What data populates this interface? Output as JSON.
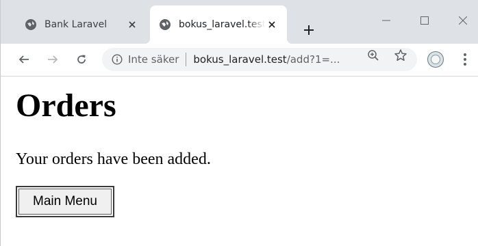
{
  "tabs": [
    {
      "title": "Bank Laravel",
      "active": false
    },
    {
      "title": "bokus_laravel.test",
      "active": true
    }
  ],
  "new_tab_label": "+",
  "omnibox": {
    "security_label": "Inte säker",
    "url_host": "bokus_laravel.test",
    "url_path": "/add?1=..."
  },
  "page": {
    "heading": "Orders",
    "message": "Your orders have been added.",
    "main_menu_label": "Main Menu"
  },
  "colors": {
    "tabstrip": "#dee1e6",
    "omnibox": "#f1f3f4",
    "icon": "#5f6368"
  }
}
